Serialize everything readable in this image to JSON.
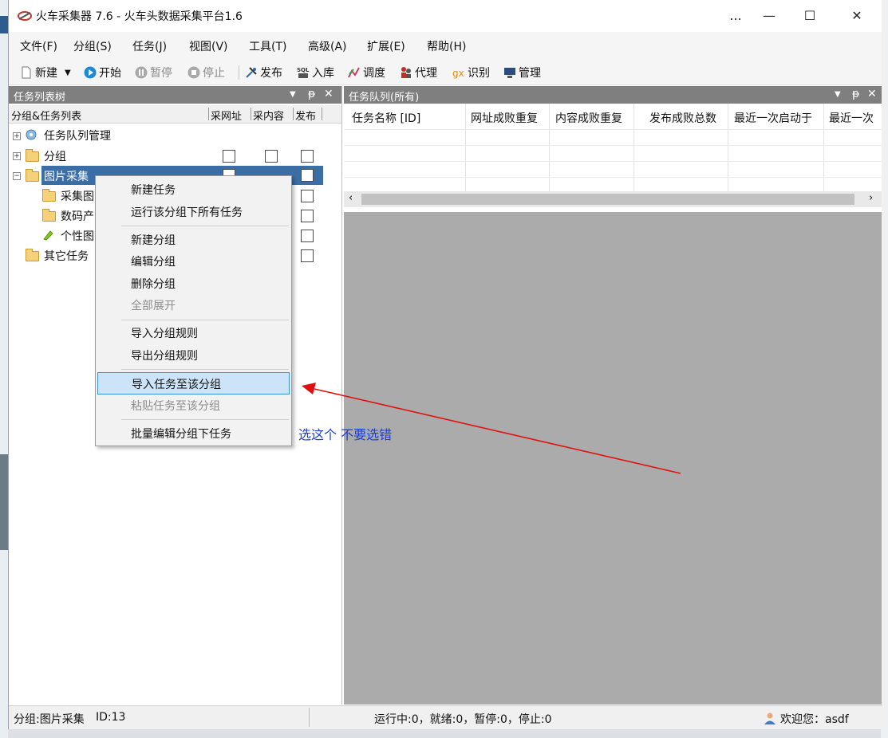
{
  "window": {
    "title": "火车采集器 7.6 - 火车头数据采集平台1.6",
    "more_glyph": "...",
    "minimize_glyph": "—",
    "maximize_glyph": "☐",
    "close_glyph": "✕"
  },
  "menu": [
    "文件(F)",
    "分组(S)",
    "任务(J)",
    "视图(V)",
    "工具(T)",
    "高级(A)",
    "扩展(E)",
    "帮助(H)"
  ],
  "toolbar": {
    "new": "新建",
    "start": "开始",
    "pause": "暂停",
    "stop": "停止",
    "publish": "发布",
    "import_db": "入库",
    "schedule": "调度",
    "proxy": "代理",
    "recognize": "识别",
    "manage": "管理"
  },
  "left_panel": {
    "title": "任务列表树",
    "header": {
      "col1": "分组&任务列表",
      "col2": "采网址",
      "col3": "采内容",
      "col4": "发布"
    },
    "rows": [
      {
        "label": "任务队列管理",
        "selected": false
      },
      {
        "label": "分组",
        "selected": false
      },
      {
        "label": "图片采集",
        "selected": true
      },
      {
        "label": "采集图",
        "selected": false
      },
      {
        "label": "数码产",
        "selected": false
      },
      {
        "label": "个性图",
        "selected": false
      },
      {
        "label": "其它任务",
        "selected": false
      }
    ]
  },
  "right_panel": {
    "title": "任务队列(所有)",
    "columns": [
      "任务名称 [ID]",
      "网址成败重复",
      "内容成败重复",
      "发布成败总数",
      "最近一次启动于",
      "最近一次"
    ]
  },
  "context_menu": {
    "items": [
      {
        "label": "新建任务",
        "disabled": false
      },
      {
        "label": "运行该分组下所有任务",
        "disabled": false
      },
      {
        "label": "新建分组",
        "disabled": false
      },
      {
        "label": "编辑分组",
        "disabled": false
      },
      {
        "label": "删除分组",
        "disabled": false
      },
      {
        "label": "全部展开",
        "disabled": true
      },
      {
        "label": "导入分组规则",
        "disabled": false
      },
      {
        "label": "导出分组规则",
        "disabled": false
      },
      {
        "label": "导入任务至该分组",
        "disabled": false,
        "highlighted": true
      },
      {
        "label": "粘贴任务至该分组",
        "disabled": true
      },
      {
        "label": "批量编辑分组下任务",
        "disabled": false
      }
    ]
  },
  "annotation": {
    "text": "选这个  不要选错",
    "arrow_color": "#e01010"
  },
  "status": {
    "group": "分组:图片采集",
    "id": "ID:13",
    "counts": "运行中:0，就绪:0，暂停:0，停止:0",
    "welcome": "欢迎您：asdf"
  },
  "colors": {
    "panel_header": "#7f7f7f",
    "selection": "#3a6ea5",
    "menu_highlight": "#cce4f7",
    "workspace": "#ababab"
  }
}
